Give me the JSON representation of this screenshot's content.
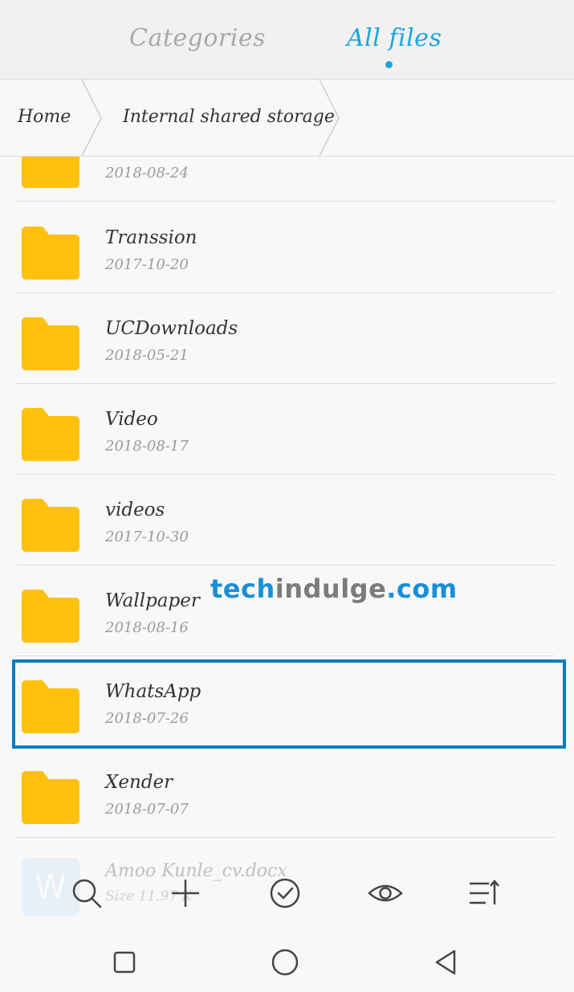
{
  "tabs": {
    "categories": "Categories",
    "all_files": "All files"
  },
  "breadcrumb": {
    "home": "Home",
    "current": "Internal shared storage"
  },
  "folders": [
    {
      "name": "",
      "date": "2018-08-24"
    },
    {
      "name": "Transsion",
      "date": "2017-10-20"
    },
    {
      "name": "UCDownloads",
      "date": "2018-05-21"
    },
    {
      "name": "Video",
      "date": "2018-08-17"
    },
    {
      "name": "videos",
      "date": "2017-10-30"
    },
    {
      "name": "Wallpaper",
      "date": "2018-08-16"
    },
    {
      "name": "WhatsApp",
      "date": "2018-07-26"
    },
    {
      "name": "Xender",
      "date": "2018-07-07"
    }
  ],
  "partial_file": {
    "name": "Amoo Kunle_cv.docx",
    "size": "Size 11.97 K"
  },
  "watermark": {
    "part1": "tech",
    "part2": "indulge",
    "part3": ".com"
  },
  "toolbar": [
    "search-icon",
    "add-icon",
    "select-check-icon",
    "view-eye-icon",
    "sort-icon"
  ],
  "colors": {
    "accent": "#1aa5dc",
    "folder": "#ffc10e",
    "highlight_border": "#0b7cc1"
  }
}
